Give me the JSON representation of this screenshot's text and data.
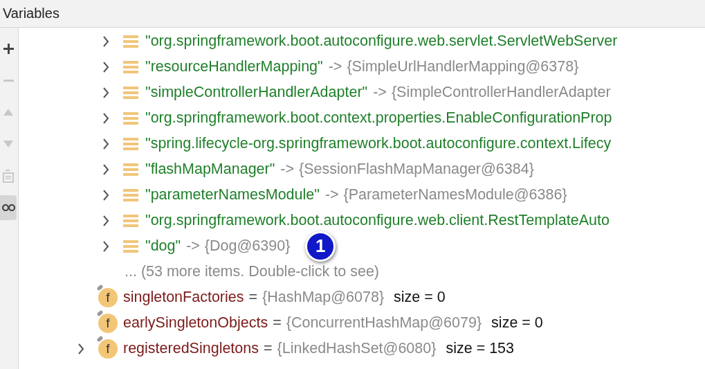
{
  "panel": {
    "title": "Variables"
  },
  "toolbar": [
    {
      "kind": "add",
      "disabled": false,
      "selected": false
    },
    {
      "kind": "remove",
      "disabled": true,
      "selected": false
    },
    {
      "kind": "up",
      "disabled": true,
      "selected": false
    },
    {
      "kind": "down",
      "disabled": true,
      "selected": false
    },
    {
      "kind": "copy",
      "disabled": true,
      "selected": false
    },
    {
      "kind": "watch",
      "disabled": false,
      "selected": true
    }
  ],
  "tree": [
    {
      "kind": "entry",
      "expanded": false,
      "key": "\"org.springframework.boot.autoconfigure.web.servlet.ServletWebServer"
    },
    {
      "kind": "entry",
      "expanded": false,
      "key": "\"resourceHandlerMapping\"",
      "arrow": "->",
      "value": "{SimpleUrlHandlerMapping@6378}"
    },
    {
      "kind": "entry",
      "expanded": false,
      "key": "\"simpleControllerHandlerAdapter\"",
      "arrow": "->",
      "value": "{SimpleControllerHandlerAdapter"
    },
    {
      "kind": "entry",
      "expanded": false,
      "key": "\"org.springframework.boot.context.properties.EnableConfigurationProp"
    },
    {
      "kind": "entry",
      "expanded": false,
      "key": "\"spring.lifecycle-org.springframework.boot.autoconfigure.context.Lifecy"
    },
    {
      "kind": "entry",
      "expanded": false,
      "key": "\"flashMapManager\"",
      "arrow": "->",
      "value": "{SessionFlashMapManager@6384}"
    },
    {
      "kind": "entry",
      "expanded": false,
      "key": "\"parameterNamesModule\"",
      "arrow": "->",
      "value": "{ParameterNamesModule@6386}"
    },
    {
      "kind": "entry",
      "expanded": false,
      "key": "\"org.springframework.boot.autoconfigure.web.client.RestTemplateAuto"
    },
    {
      "kind": "entry",
      "expanded": false,
      "key": "\"dog\"",
      "arrow": "->",
      "value": "{Dog@6390}",
      "badge": "1"
    },
    {
      "kind": "more",
      "text": "... (53 more items. Double-click to see)"
    },
    {
      "kind": "field",
      "expandable": false,
      "icon_text": "f",
      "name": "singletonFactories",
      "eq": "=",
      "value": "{HashMap@6078}",
      "size": "size = 0"
    },
    {
      "kind": "field",
      "expandable": false,
      "icon_text": "f",
      "name": "earlySingletonObjects",
      "eq": "=",
      "value": "{ConcurrentHashMap@6079}",
      "size": "size = 0"
    },
    {
      "kind": "field",
      "expandable": true,
      "icon_text": "f",
      "name": "registeredSingletons",
      "eq": "=",
      "value": "{LinkedHashSet@6080}",
      "size": "size = 153"
    }
  ]
}
